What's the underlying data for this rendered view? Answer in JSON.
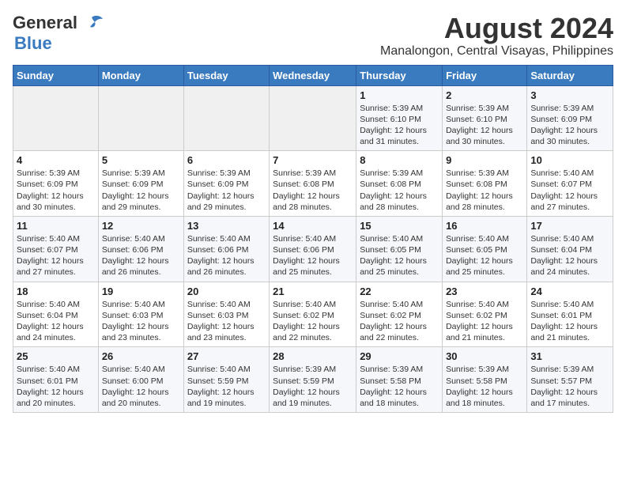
{
  "header": {
    "logo_general": "General",
    "logo_blue": "Blue",
    "title": "August 2024",
    "subtitle": "Manalongon, Central Visayas, Philippines"
  },
  "weekdays": [
    "Sunday",
    "Monday",
    "Tuesday",
    "Wednesday",
    "Thursday",
    "Friday",
    "Saturday"
  ],
  "weeks": [
    [
      {
        "day": "",
        "info": ""
      },
      {
        "day": "",
        "info": ""
      },
      {
        "day": "",
        "info": ""
      },
      {
        "day": "",
        "info": ""
      },
      {
        "day": "1",
        "info": "Sunrise: 5:39 AM\nSunset: 6:10 PM\nDaylight: 12 hours\nand 31 minutes."
      },
      {
        "day": "2",
        "info": "Sunrise: 5:39 AM\nSunset: 6:10 PM\nDaylight: 12 hours\nand 30 minutes."
      },
      {
        "day": "3",
        "info": "Sunrise: 5:39 AM\nSunset: 6:09 PM\nDaylight: 12 hours\nand 30 minutes."
      }
    ],
    [
      {
        "day": "4",
        "info": "Sunrise: 5:39 AM\nSunset: 6:09 PM\nDaylight: 12 hours\nand 30 minutes."
      },
      {
        "day": "5",
        "info": "Sunrise: 5:39 AM\nSunset: 6:09 PM\nDaylight: 12 hours\nand 29 minutes."
      },
      {
        "day": "6",
        "info": "Sunrise: 5:39 AM\nSunset: 6:09 PM\nDaylight: 12 hours\nand 29 minutes."
      },
      {
        "day": "7",
        "info": "Sunrise: 5:39 AM\nSunset: 6:08 PM\nDaylight: 12 hours\nand 28 minutes."
      },
      {
        "day": "8",
        "info": "Sunrise: 5:39 AM\nSunset: 6:08 PM\nDaylight: 12 hours\nand 28 minutes."
      },
      {
        "day": "9",
        "info": "Sunrise: 5:39 AM\nSunset: 6:08 PM\nDaylight: 12 hours\nand 28 minutes."
      },
      {
        "day": "10",
        "info": "Sunrise: 5:40 AM\nSunset: 6:07 PM\nDaylight: 12 hours\nand 27 minutes."
      }
    ],
    [
      {
        "day": "11",
        "info": "Sunrise: 5:40 AM\nSunset: 6:07 PM\nDaylight: 12 hours\nand 27 minutes."
      },
      {
        "day": "12",
        "info": "Sunrise: 5:40 AM\nSunset: 6:06 PM\nDaylight: 12 hours\nand 26 minutes."
      },
      {
        "day": "13",
        "info": "Sunrise: 5:40 AM\nSunset: 6:06 PM\nDaylight: 12 hours\nand 26 minutes."
      },
      {
        "day": "14",
        "info": "Sunrise: 5:40 AM\nSunset: 6:06 PM\nDaylight: 12 hours\nand 25 minutes."
      },
      {
        "day": "15",
        "info": "Sunrise: 5:40 AM\nSunset: 6:05 PM\nDaylight: 12 hours\nand 25 minutes."
      },
      {
        "day": "16",
        "info": "Sunrise: 5:40 AM\nSunset: 6:05 PM\nDaylight: 12 hours\nand 25 minutes."
      },
      {
        "day": "17",
        "info": "Sunrise: 5:40 AM\nSunset: 6:04 PM\nDaylight: 12 hours\nand 24 minutes."
      }
    ],
    [
      {
        "day": "18",
        "info": "Sunrise: 5:40 AM\nSunset: 6:04 PM\nDaylight: 12 hours\nand 24 minutes."
      },
      {
        "day": "19",
        "info": "Sunrise: 5:40 AM\nSunset: 6:03 PM\nDaylight: 12 hours\nand 23 minutes."
      },
      {
        "day": "20",
        "info": "Sunrise: 5:40 AM\nSunset: 6:03 PM\nDaylight: 12 hours\nand 23 minutes."
      },
      {
        "day": "21",
        "info": "Sunrise: 5:40 AM\nSunset: 6:02 PM\nDaylight: 12 hours\nand 22 minutes."
      },
      {
        "day": "22",
        "info": "Sunrise: 5:40 AM\nSunset: 6:02 PM\nDaylight: 12 hours\nand 22 minutes."
      },
      {
        "day": "23",
        "info": "Sunrise: 5:40 AM\nSunset: 6:02 PM\nDaylight: 12 hours\nand 21 minutes."
      },
      {
        "day": "24",
        "info": "Sunrise: 5:40 AM\nSunset: 6:01 PM\nDaylight: 12 hours\nand 21 minutes."
      }
    ],
    [
      {
        "day": "25",
        "info": "Sunrise: 5:40 AM\nSunset: 6:01 PM\nDaylight: 12 hours\nand 20 minutes."
      },
      {
        "day": "26",
        "info": "Sunrise: 5:40 AM\nSunset: 6:00 PM\nDaylight: 12 hours\nand 20 minutes."
      },
      {
        "day": "27",
        "info": "Sunrise: 5:40 AM\nSunset: 5:59 PM\nDaylight: 12 hours\nand 19 minutes."
      },
      {
        "day": "28",
        "info": "Sunrise: 5:39 AM\nSunset: 5:59 PM\nDaylight: 12 hours\nand 19 minutes."
      },
      {
        "day": "29",
        "info": "Sunrise: 5:39 AM\nSunset: 5:58 PM\nDaylight: 12 hours\nand 18 minutes."
      },
      {
        "day": "30",
        "info": "Sunrise: 5:39 AM\nSunset: 5:58 PM\nDaylight: 12 hours\nand 18 minutes."
      },
      {
        "day": "31",
        "info": "Sunrise: 5:39 AM\nSunset: 5:57 PM\nDaylight: 12 hours\nand 17 minutes."
      }
    ]
  ]
}
